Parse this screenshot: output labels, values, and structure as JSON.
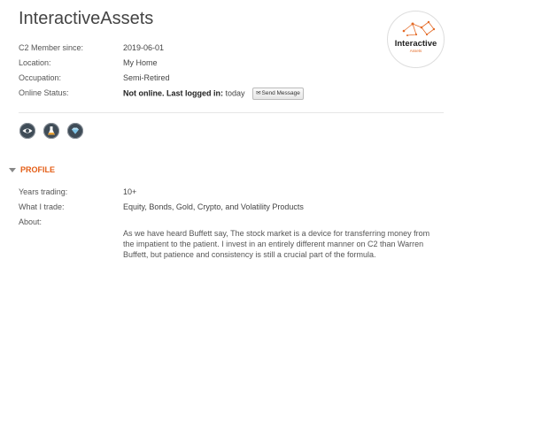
{
  "profile": {
    "username": "InteractiveAssets",
    "member_since_label": "C2 Member since:",
    "member_since": "2019-06-01",
    "location_label": "Location:",
    "location": "My Home",
    "occupation_label": "Occupation:",
    "occupation": "Semi-Retired",
    "online_label": "Online Status:",
    "online_status": "Not online. Last logged in:",
    "last_login": "today",
    "send_message": "Send Message"
  },
  "logo": {
    "name": "Interactive",
    "sub": "Assets",
    "accent": "#e46b27"
  },
  "badges": [
    {
      "icon": "eye-icon"
    },
    {
      "icon": "flask-icon"
    },
    {
      "icon": "diamond-icon"
    }
  ],
  "section": {
    "title": "PROFILE",
    "color": "#e45e17"
  },
  "details": {
    "years_label": "Years trading:",
    "years": "10+",
    "trade_label": "What I trade:",
    "trade": "Equity, Bonds, Gold, Crypto, and Volatility Products",
    "about_label": "About:",
    "about": "As we have heard Buffett say, The stock market is a device for transferring money from the impatient to the patient. I invest in an entirely different manner on C2 than Warren Buffett, but patience and consistency is still a crucial part of the formula."
  }
}
